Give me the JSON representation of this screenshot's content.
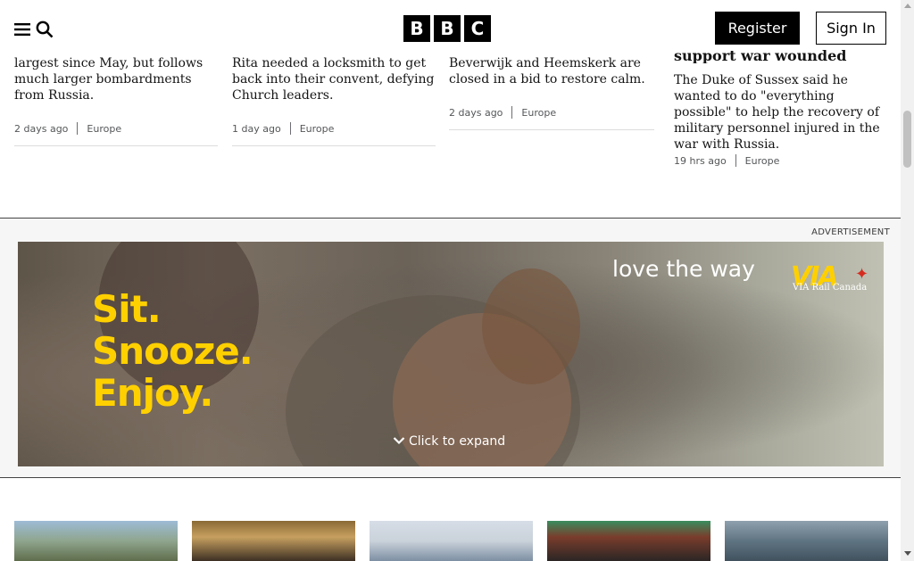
{
  "header": {
    "logo_letters": [
      "B",
      "B",
      "C"
    ],
    "register_label": "Register",
    "signin_label": "Sign In",
    "menu_icon": "menu-icon",
    "search_icon": "search-icon"
  },
  "stories": [
    {
      "summary": "largest since May, but follows much larger bombardments from Russia.",
      "time": "2 days ago",
      "section": "Europe"
    },
    {
      "summary": "Rita needed a locksmith to get back into their convent, defying Church leaders.",
      "time": "1 day ago",
      "section": "Europe"
    },
    {
      "summary": "Beverwijk and Heemskerk are closed in a bid to restore calm.",
      "time": "2 days ago",
      "section": "Europe"
    },
    {
      "headline": "support war wounded",
      "summary": "The Duke of Sussex said he wanted to do \"everything possible\" to help the recovery of military personnel injured in the war with Russia.",
      "time": "19 hrs ago",
      "section": "Europe"
    }
  ],
  "advert": {
    "label": "ADVERTISEMENT",
    "taglines": [
      "Sit.",
      "Snooze.",
      "Enjoy."
    ],
    "slogan": "love the way",
    "brand": "VIA",
    "brand_sub": "VIA Rail Canada",
    "expand_label": "Click to expand",
    "accent_color": "#ffd000"
  },
  "colors": {
    "text": "#141414",
    "meta": "#545658",
    "button_bg": "#000000"
  }
}
